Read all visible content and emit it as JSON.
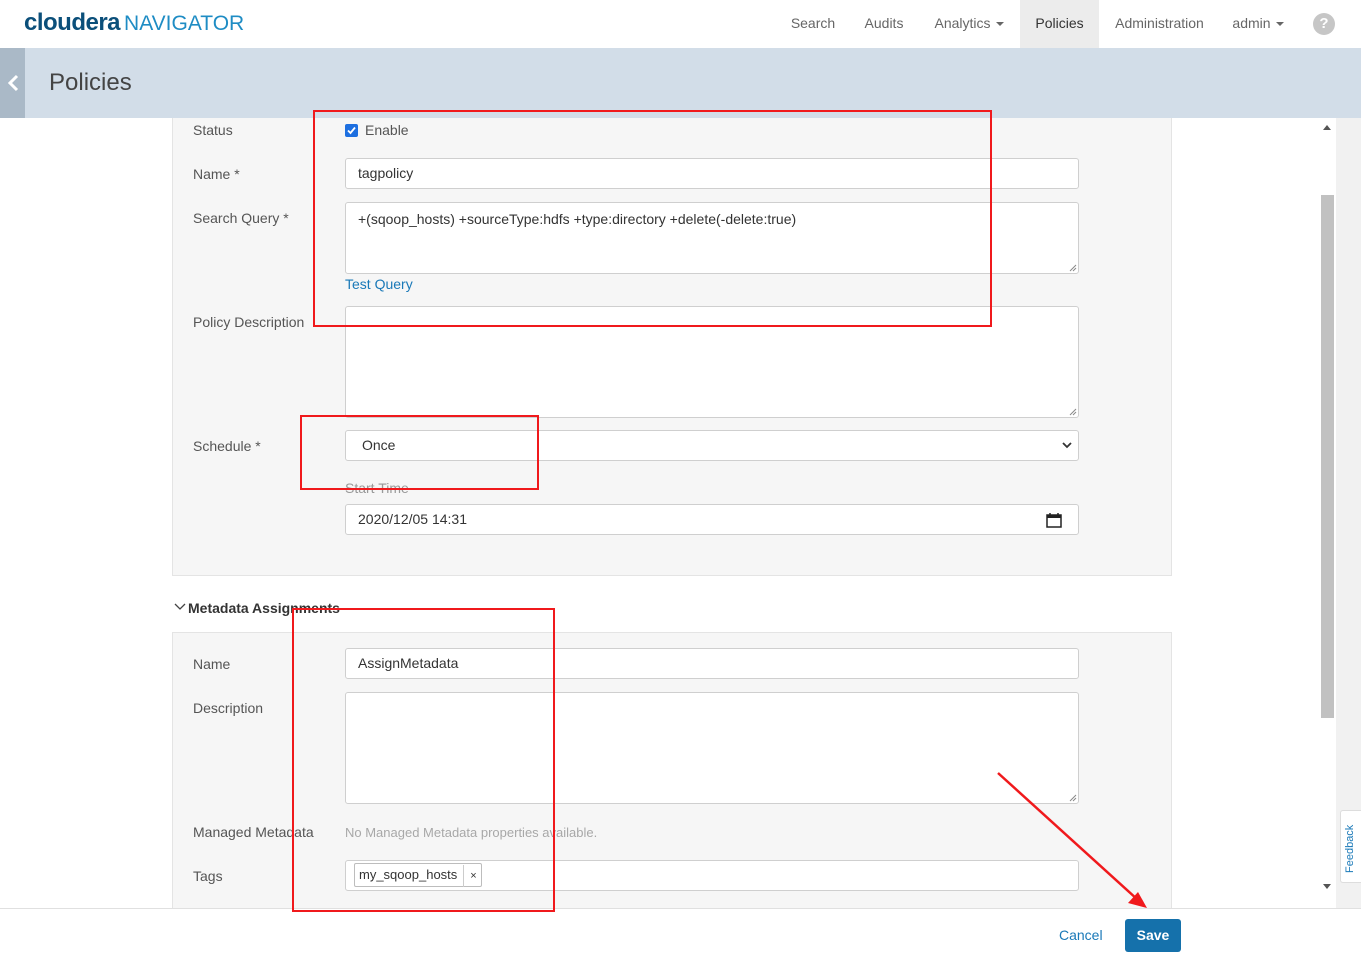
{
  "app": {
    "brand": "cloudera",
    "product": "NAVIGATOR"
  },
  "nav": {
    "search": "Search",
    "audits": "Audits",
    "analytics": "Analytics",
    "policies": "Policies",
    "administration": "Administration",
    "user": "admin",
    "help": "?"
  },
  "header": {
    "title": "Policies"
  },
  "policy": {
    "status_label": "Status",
    "enable_label": "Enable",
    "enabled": true,
    "name_label": "Name *",
    "name_value": "tagpolicy",
    "query_label": "Search Query *",
    "query_value": "+(sqoop_hosts) +sourceType:hdfs +type:directory +delete(-delete:true)",
    "test_query": "Test Query",
    "description_label": "Policy Description",
    "description_value": "",
    "schedule_label": "Schedule *",
    "schedule_value": "Once",
    "start_time_label": "Start Time",
    "start_time_value": "2020/12/05 14:31"
  },
  "metadata": {
    "section_title": "Metadata Assignments",
    "name_label": "Name",
    "name_value": "AssignMetadata",
    "description_label": "Description",
    "description_value": "",
    "managed_label": "Managed Metadata",
    "managed_empty": "No Managed Metadata properties available.",
    "tags_label": "Tags",
    "tags": [
      "my_sqoop_hosts"
    ],
    "tag_remove": "×"
  },
  "feedback": "Feedback",
  "footer": {
    "cancel": "Cancel",
    "save": "Save"
  },
  "colors": {
    "accent": "#1571ab",
    "link": "#1a79b8",
    "annotation": "#f0191c"
  }
}
